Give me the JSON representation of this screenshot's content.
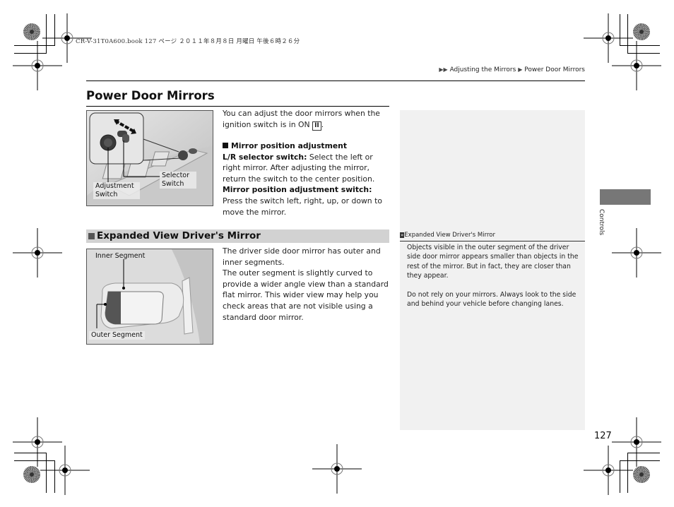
{
  "print_header": {
    "text": "CR-V-31T0A600.book  127 ページ  ２０１１年８月８日  月曜日  午後６時２６分"
  },
  "breadcrumb": {
    "separator_icon": "double-triangle-right-icon",
    "items": [
      "Adjusting the Mirrors",
      "Power Door Mirrors"
    ]
  },
  "page": {
    "title": "Power Door Mirrors",
    "number": "127",
    "side_tab": "Controls"
  },
  "section1": {
    "intro_line1": "You can adjust the door mirrors when the",
    "intro_line2": "ignition switch is in ON",
    "ignition_key": "II",
    "intro_end": ".",
    "subheading": "Mirror position adjustment",
    "lr_label": "L/R selector switch:",
    "lr_text": " Select the left or right mirror. After adjusting the mirror, return the switch to the center position.",
    "adj_label": "Mirror position adjustment switch:",
    "adj_text": " Press the switch left, right, up, or down to move the mirror.",
    "figure": {
      "label_selector": "Selector Switch",
      "label_adjustment": "Adjustment Switch"
    }
  },
  "section2": {
    "heading": "Expanded View Driver's Mirror",
    "paragraph1": "The driver side door mirror has outer and inner segments.",
    "paragraph2": "The outer segment is slightly curved to provide a wider angle view than a standard flat mirror. This wider view may help you check areas that are not visible using a standard door mirror.",
    "figure": {
      "label_inner": "Inner Segment",
      "label_outer": "Outer Segment"
    }
  },
  "side_note": {
    "heading": "Expanded View Driver's Mirror",
    "paragraph1": "Objects visible in the outer segment of the driver side door mirror appears smaller than objects in the rest of the mirror. But in fact, they are closer than they appear.",
    "paragraph2": "Do not rely on your mirrors. Always look to the side and behind your vehicle before changing lanes."
  }
}
